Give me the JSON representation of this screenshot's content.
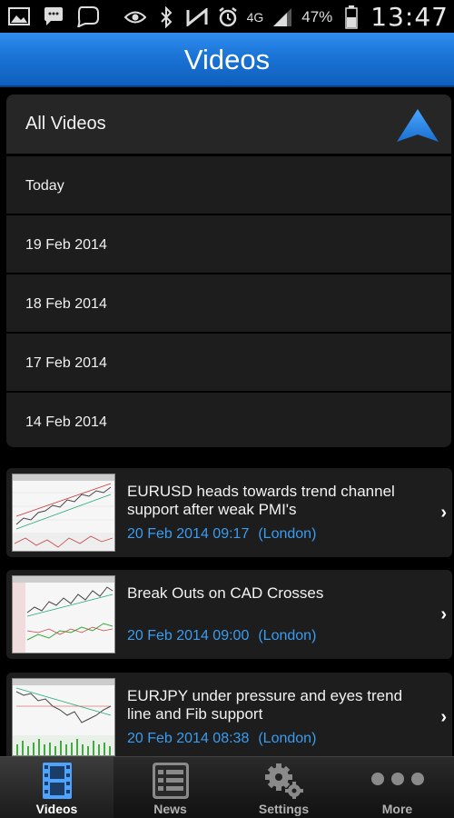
{
  "status_bar": {
    "network": "4G",
    "battery": "47%",
    "time": "13:47"
  },
  "header": {
    "title": "Videos"
  },
  "filter": {
    "selected": "All Videos",
    "options": [
      "Today",
      "19 Feb 2014",
      "18 Feb 2014",
      "17 Feb 2014",
      "14 Feb 2014"
    ]
  },
  "videos": [
    {
      "title": "EURUSD heads towards trend channel support after weak PMI's",
      "datetime": "20 Feb 2014 09:17",
      "location": "(London)"
    },
    {
      "title": "Break Outs on CAD Crosses",
      "datetime": "20 Feb 2014 09:00",
      "location": "(London)"
    },
    {
      "title": "EURJPY under pressure and eyes trend line and Fib support",
      "datetime": "20 Feb 2014 08:38",
      "location": "(London)"
    }
  ],
  "tabs": [
    {
      "label": "Videos",
      "icon": "film-icon"
    },
    {
      "label": "News",
      "icon": "news-list-icon"
    },
    {
      "label": "Settings",
      "icon": "gears-icon"
    },
    {
      "label": "More",
      "icon": "more-dots-icon"
    }
  ],
  "colors": {
    "accent": "#1a74d6",
    "link": "#3a9cf0",
    "background": "#000000"
  }
}
